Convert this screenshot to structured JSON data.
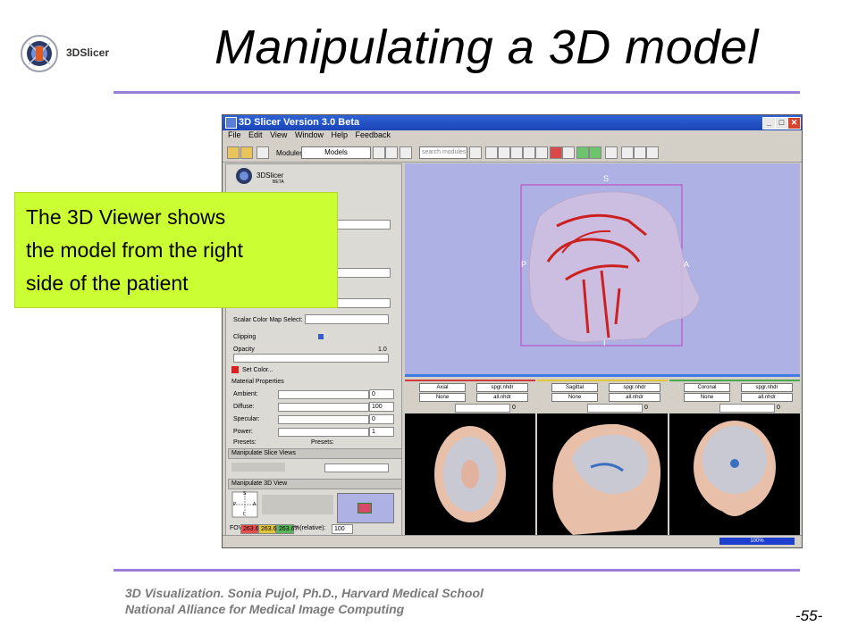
{
  "slide": {
    "title": "Manipulating a 3D model",
    "footer_line1": "3D Visualization. Sonia Pujol, Ph.D., Harvard Medical School",
    "footer_line2": "National Alliance for Medical Image Computing",
    "page_number": "-55-",
    "logo_text": "3DSlicer",
    "accent_color": "#9b7fd6"
  },
  "callout": {
    "lines": [
      "The 3D Viewer shows",
      "the model from the right",
      "side of the patient"
    ],
    "color": "#ccff33"
  },
  "app": {
    "window_title": "3D Slicer Version 3.0 Beta",
    "menu": [
      "File",
      "Edit",
      "View",
      "Window",
      "Help",
      "Feedback"
    ],
    "modules_label": "Modules:",
    "module_selected": "Models",
    "search_placeholder": "search modules",
    "panel_logo": "3DSlicer",
    "panel_logo_sub": "BETA",
    "scalar_color_map_label": "Scalar Color Map Select:",
    "clipping_label": "Clipping",
    "opacity_label": "Opacity",
    "opacity_value": "1.0",
    "set_color_label": "Set Color...",
    "material_properties_label": "Material Properties",
    "ambient_label": "Ambient:",
    "ambient_value": "0",
    "diffuse_label": "Diffuse:",
    "diffuse_value": "100",
    "specular_label": "Specular:",
    "specular_value": "0",
    "power_label": "Power:",
    "power_value": "1",
    "presets_left": "Presets:",
    "presets_right": "Presets:",
    "manip_slice_label": "Manipulate Slice Views",
    "manip_3d_label": "Manipulate 3D View",
    "fov_label": "FOV:",
    "fov_values": [
      "263.67",
      "263.67",
      "263.67"
    ],
    "zoom_label": "%(relative):",
    "zoom_value": "100",
    "orient_labels": {
      "S": "S",
      "P": "P",
      "A": "A",
      "I": "I"
    },
    "progress_text": "100%",
    "slice_views": [
      {
        "orientation": "Axial",
        "volume": "spgr.nhdr",
        "label_sel": "None",
        "label_vol": "all.nhdr",
        "offset": "0",
        "color": "#d33b3b"
      },
      {
        "orientation": "Sagittal",
        "volume": "spgr.nhdr",
        "label_sel": "None",
        "label_vol": "all.nhdr",
        "offset": "0",
        "color": "#e3c53a"
      },
      {
        "orientation": "Coronal",
        "volume": "spgr.nhdr",
        "label_sel": "None",
        "label_vol": "all.nhdr",
        "offset": "0",
        "color": "#4aa84a"
      }
    ]
  }
}
